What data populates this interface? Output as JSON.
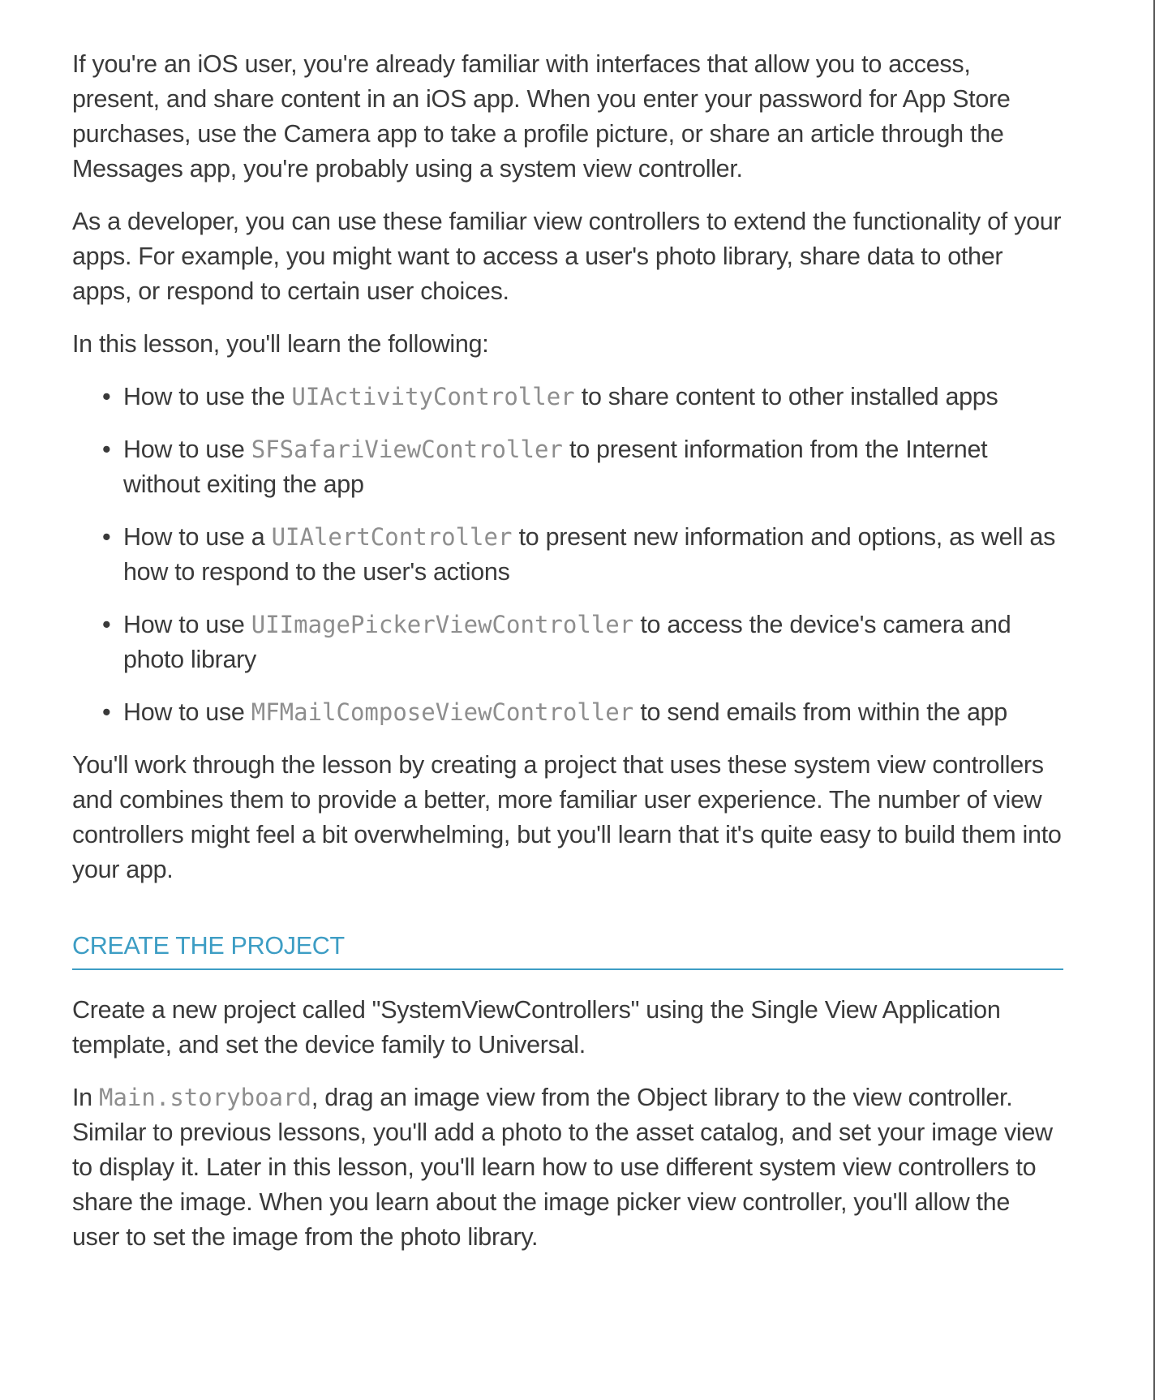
{
  "intro": {
    "p1": "If you're an iOS user, you're already familiar with interfaces that allow you to access, present, and share content in an iOS app. When you enter your password for App Store purchases, use the Camera app to take a profile picture, or share an article through the Messages app, you're probably using a system view controller.",
    "p2": "As a developer, you can use these familiar view controllers to extend the functionality of your apps. For example, you might want to access a user's photo library, share data to other apps, or respond to certain user choices.",
    "p3": "In this lesson, you'll learn the following:"
  },
  "bullets": [
    {
      "before": "How to use the ",
      "code": "UIActivityController",
      "after": " to share content to other installed apps"
    },
    {
      "before": "How to use ",
      "code": "SFSafariViewController",
      "after": " to present information from the Internet without exiting the app"
    },
    {
      "before": "How to use a ",
      "code": "UIAlertController",
      "after": " to present new information and options, as well as how to respond to the user's actions"
    },
    {
      "before": "How to use ",
      "code": "UIImagePickerViewController",
      "after": " to access the device's camera and photo library"
    },
    {
      "before": "How to use ",
      "code": "MFMailComposeViewController",
      "after": " to send emails from within the app"
    }
  ],
  "summary": "You'll work through the lesson by creating a project that uses these system view controllers and combines them to provide a better, more familiar user experience. The number of view controllers might feel a bit overwhelming, but you'll learn that it's quite easy to build them into your app.",
  "section": {
    "heading": "CREATE THE PROJECT",
    "p1": "Create a new project called \"SystemViewControllers\" using the Single View Application template, and set the device family to Universal.",
    "p2_before": "In ",
    "p2_code": "Main.storyboard",
    "p2_after": ", drag an image view from the Object library to the view controller. Similar to previous lessons, you'll add a photo to the asset catalog, and set your image view to display it. Later in this lesson, you'll learn how to use different system view controllers to share the image. When you learn about the image picker view controller, you'll allow the user to set the image from the photo library."
  },
  "colors": {
    "heading": "#3d9dc4",
    "body_text": "#3a3a3a",
    "code_text": "#8e8e8e"
  }
}
